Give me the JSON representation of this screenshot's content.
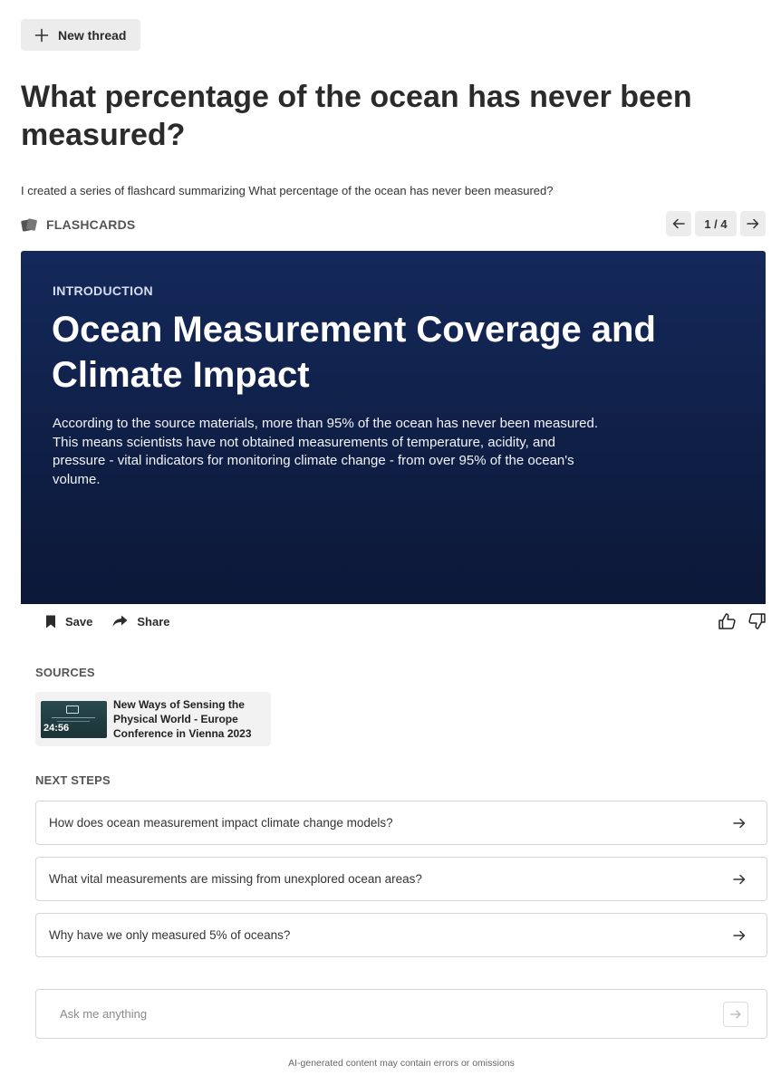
{
  "new_thread": {
    "label": "New thread",
    "icon": "plus-icon"
  },
  "title": "What percentage of the ocean has never been measured?",
  "intro_text": "I created a series of flashcard summarizing What percentage of the ocean has never been measured?",
  "flashcards": {
    "label": "FLASHCARDS",
    "icon": "flashcards-icon",
    "page_indicator": "1 / 4",
    "card": {
      "eyebrow": "INTRODUCTION",
      "title": "Ocean Measurement Coverage and Climate Impact",
      "body": "According to the source materials, more than 95% of the ocean has never been measured. This means scientists have not obtained measurements of temperature, acidity, and pressure - vital indicators for monitoring climate change - from over 95% of the ocean's volume.",
      "background_color": "#112553"
    }
  },
  "actions": {
    "save_label": "Save",
    "share_label": "Share"
  },
  "sources": {
    "label": "SOURCES",
    "items": [
      {
        "title": "New Ways of Sensing the Physical World - Europe Conference in Vienna 2023",
        "duration": "24:56"
      }
    ]
  },
  "next_steps": {
    "label": "NEXT STEPS",
    "items": [
      {
        "text": "How does ocean measurement impact climate change models?"
      },
      {
        "text": "What vital measurements are missing from unexplored ocean areas?"
      },
      {
        "text": "Why have we only measured 5% of oceans?"
      }
    ]
  },
  "ask": {
    "placeholder": "Ask me anything"
  },
  "disclaimer": "AI-generated content may contain errors or omissions"
}
